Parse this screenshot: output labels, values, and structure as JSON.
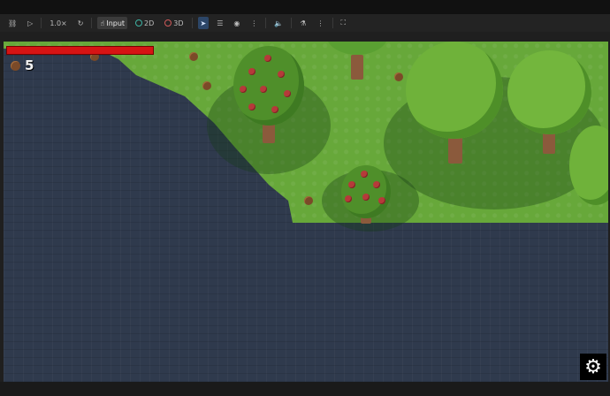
{
  "toolbar": {
    "zoom": "1.0×",
    "input_label": "Input",
    "mode_2d": "2D",
    "mode_3d": "3D",
    "icons": [
      "link-icon",
      "play-icon",
      "refresh-icon",
      "hand-icon",
      "cursor-icon",
      "list-icon",
      "eye-icon",
      "more-icon",
      "volume-icon",
      "paint-icon",
      "more-icon",
      "fullscreen-icon"
    ]
  },
  "hud": {
    "health": 1.0,
    "acorn_count": "5",
    "settings_icon": "gear-icon"
  },
  "colors": {
    "health": "#d61414",
    "grass": "#67a83a",
    "water": "#2f3a4d",
    "tree_leaf": "#4f8f2a",
    "fruit": "#b63a3a"
  }
}
